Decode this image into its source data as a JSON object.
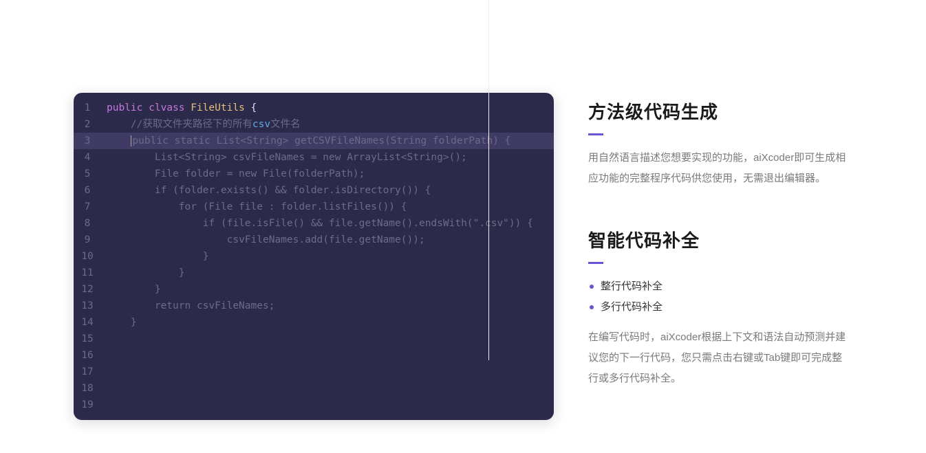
{
  "code": {
    "lines": [
      {
        "n": 1,
        "segs": [
          {
            "t": "public ",
            "c": "k-purple"
          },
          {
            "t": "clvass ",
            "c": "k-purple"
          },
          {
            "t": "FileUtils ",
            "c": "k-yellow"
          },
          {
            "t": "{",
            "c": "k-white"
          }
        ],
        "highlight": false,
        "cursor": false
      },
      {
        "n": 2,
        "indent": "    ",
        "segs": [
          {
            "t": "//获取文件夹路径下的所有",
            "c": "k-comment"
          },
          {
            "t": "csv",
            "c": "k-csv"
          },
          {
            "t": "文件名",
            "c": "k-comment"
          }
        ],
        "highlight": false,
        "cursor": false
      },
      {
        "n": 3,
        "indent": "    ",
        "segs": [
          {
            "t": "public static List<String> getCSVFileNames(String folderPath) {",
            "c": "k-ghost"
          }
        ],
        "highlight": true,
        "cursor": true
      },
      {
        "n": 4,
        "indent": "        ",
        "segs": [
          {
            "t": "List<String> csvFileNames = new ArrayList<String>();",
            "c": "k-ghost"
          }
        ],
        "highlight": false,
        "cursor": false
      },
      {
        "n": 5,
        "indent": "        ",
        "segs": [
          {
            "t": "File folder = new File(folderPath);",
            "c": "k-ghost"
          }
        ],
        "highlight": false,
        "cursor": false
      },
      {
        "n": 6,
        "indent": "        ",
        "segs": [
          {
            "t": "if (folder.exists() && folder.isDirectory()) {",
            "c": "k-ghost"
          }
        ],
        "highlight": false,
        "cursor": false
      },
      {
        "n": 7,
        "indent": "            ",
        "segs": [
          {
            "t": "for (File file : folder.listFiles()) {",
            "c": "k-ghost"
          }
        ],
        "highlight": false,
        "cursor": false
      },
      {
        "n": 8,
        "indent": "                ",
        "segs": [
          {
            "t": "if (file.isFile() && file.getName().endsWith(\".csv\")) {",
            "c": "k-ghost"
          }
        ],
        "highlight": false,
        "cursor": false
      },
      {
        "n": 9,
        "indent": "                    ",
        "segs": [
          {
            "t": "csvFileNames.add(file.getName());",
            "c": "k-ghost"
          }
        ],
        "highlight": false,
        "cursor": false
      },
      {
        "n": 10,
        "indent": "                ",
        "segs": [
          {
            "t": "}",
            "c": "k-ghost"
          }
        ],
        "highlight": false,
        "cursor": false
      },
      {
        "n": 11,
        "indent": "            ",
        "segs": [
          {
            "t": "}",
            "c": "k-ghost"
          }
        ],
        "highlight": false,
        "cursor": false
      },
      {
        "n": 12,
        "indent": "        ",
        "segs": [
          {
            "t": "}",
            "c": "k-ghost"
          }
        ],
        "highlight": false,
        "cursor": false
      },
      {
        "n": 13,
        "indent": "        ",
        "segs": [
          {
            "t": "return csvFileNames;",
            "c": "k-ghost"
          }
        ],
        "highlight": false,
        "cursor": false
      },
      {
        "n": 14,
        "indent": "    ",
        "segs": [
          {
            "t": "}",
            "c": "k-ghost"
          }
        ],
        "highlight": false,
        "cursor": false
      },
      {
        "n": 15,
        "segs": [],
        "highlight": false,
        "cursor": false
      },
      {
        "n": 16,
        "segs": [],
        "highlight": false,
        "cursor": false
      },
      {
        "n": 17,
        "segs": [],
        "highlight": false,
        "cursor": false
      },
      {
        "n": 18,
        "segs": [],
        "highlight": false,
        "cursor": false
      },
      {
        "n": 19,
        "segs": [],
        "highlight": false,
        "cursor": false
      }
    ]
  },
  "sections": {
    "s1": {
      "title": "方法级代码生成",
      "desc": "用自然语言描述您想要实现的功能，aiXcoder即可生成相应功能的完整程序代码供您使用，无需退出编辑器。"
    },
    "s2": {
      "title": "智能代码补全",
      "bullets": [
        "整行代码补全",
        "多行代码补全"
      ],
      "desc": "在编写代码时，aiXcoder根据上下文和语法自动预测并建议您的下一行代码，您只需点击右键或Tab键即可完成整行或多行代码补全。"
    }
  }
}
